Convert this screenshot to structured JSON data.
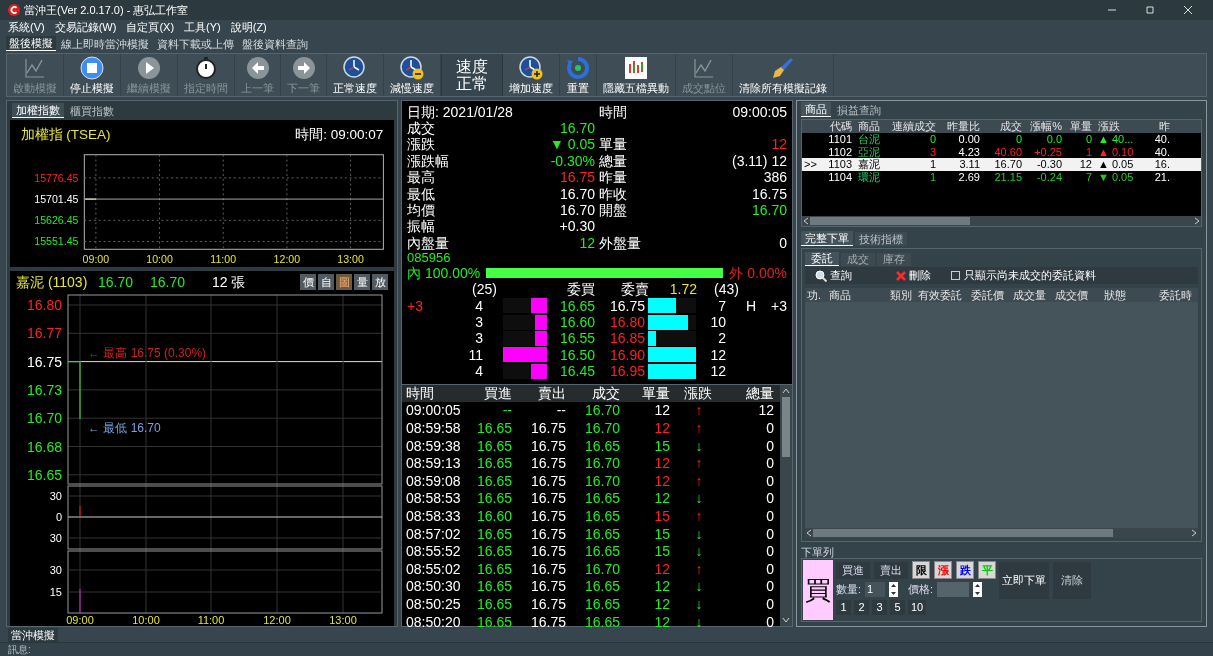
{
  "window": {
    "title": "當沖王(Ver 2.0.17.0) - 惠弘工作室"
  },
  "menu": [
    "系統(V)",
    "交易記錄(W)",
    "自定頁(X)",
    "工具(Y)",
    "說明(Z)"
  ],
  "tabs": [
    {
      "label": "盤後模擬",
      "selected": true
    },
    {
      "label": "線上即時當沖模擬",
      "selected": false
    },
    {
      "label": "資料下載或上傳",
      "selected": false
    },
    {
      "label": "盤後資料查詢",
      "selected": false
    }
  ],
  "toolbar": [
    {
      "kind": "button",
      "label": "啟動模擬",
      "disabled": true
    },
    {
      "kind": "button",
      "label": "停止模擬",
      "disabled": false
    },
    {
      "kind": "button",
      "label": "繼續模擬",
      "disabled": true
    },
    {
      "kind": "button",
      "label": "指定時間",
      "disabled": true
    },
    {
      "kind": "button",
      "label": "上一筆",
      "disabled": true
    },
    {
      "kind": "button",
      "label": "下一筆",
      "disabled": true
    },
    {
      "kind": "button",
      "label": "正常速度",
      "disabled": false
    },
    {
      "kind": "button",
      "label": "減慢速度",
      "disabled": false
    },
    {
      "kind": "display",
      "lines": [
        "速度",
        "正常"
      ]
    },
    {
      "kind": "button",
      "label": "增加速度",
      "disabled": false
    },
    {
      "kind": "button",
      "label": "重置",
      "disabled": false
    },
    {
      "kind": "button",
      "label": "隱藏五檔異動",
      "disabled": false
    },
    {
      "kind": "button",
      "label": "成交點位",
      "disabled": true
    },
    {
      "kind": "button",
      "label": "清除所有模擬記錄",
      "disabled": false
    }
  ],
  "index_panel": {
    "tabs": [
      {
        "label": "加權指數",
        "selected": true
      },
      {
        "label": "櫃買指數",
        "selected": false
      }
    ],
    "title": "加權指 (TSEA)",
    "time": "時間: 09:00:07",
    "y_labels": [
      {
        "text": "15776.45",
        "color": "#ff2020"
      },
      {
        "text": "15701.45",
        "color": "#ffffff"
      },
      {
        "text": "15626.45",
        "color": "#22ee22"
      },
      {
        "text": "15551.45",
        "color": "#22ee22"
      }
    ],
    "x_labels": [
      "09:00",
      "10:00",
      "11:00",
      "12:00",
      "13:00"
    ]
  },
  "stock_chart": {
    "name": "嘉泥 (1103)",
    "price": "16.70",
    "open": "16.70",
    "volume": "12 張",
    "buttons": [
      {
        "label": "價",
        "selected": false
      },
      {
        "label": "自",
        "selected": false
      },
      {
        "label": "圖",
        "selected": true
      },
      {
        "label": "量",
        "selected": false
      },
      {
        "label": "放",
        "selected": false
      }
    ],
    "price_labels": [
      {
        "text": "16.80",
        "color": "#ff2020"
      },
      {
        "text": "16.77",
        "color": "#ff2020"
      },
      {
        "text": "16.75",
        "color": "#ffffff"
      },
      {
        "text": "16.73",
        "color": "#22ee22"
      },
      {
        "text": "16.70",
        "color": "#22ee22"
      },
      {
        "text": "16.68",
        "color": "#22ee22"
      },
      {
        "text": "16.65",
        "color": "#22ee22"
      }
    ],
    "high_note": "← 最高 16.75 (0.30%)",
    "low_note": "← 最低 16.70",
    "volume_labels": [
      "30",
      "0",
      "30"
    ],
    "lower_labels": [
      "30",
      "15"
    ],
    "x_labels": [
      "09:00",
      "10:00",
      "11:00",
      "12:00",
      "13:00"
    ]
  },
  "quote": {
    "date": "日期: 2021/01/28",
    "time_label": "時間",
    "time": "09:00:05",
    "rows": [
      {
        "left": {
          "label": "成交",
          "value": "16.70",
          "color": "#22ee22"
        }
      },
      {
        "left": {
          "label": "漲跌",
          "value": "▼ 0.05",
          "color": "#22ee22"
        },
        "right": {
          "label": "單量",
          "value": "12",
          "color": "#ff2020"
        }
      },
      {
        "left": {
          "label": "漲跌幅",
          "value": "-0.30%",
          "color": "#22ee22"
        },
        "right": {
          "label": "總量",
          "value": "(3.11) 12",
          "color": "#ffffff"
        }
      },
      {
        "left": {
          "label": "最高",
          "value": "16.75",
          "color": "#ff2020"
        },
        "right": {
          "label": "昨量",
          "value": "386",
          "color": "#ffffff"
        }
      },
      {
        "left": {
          "label": "最低",
          "value": "16.70",
          "color": "#ffffff"
        },
        "right": {
          "label": "昨收",
          "value": "16.75",
          "color": "#ffffff"
        }
      },
      {
        "left": {
          "label": "均價",
          "value": "16.70",
          "color": "#ffffff"
        },
        "right": {
          "label": "開盤",
          "value": "16.70",
          "color": "#22ee22"
        }
      },
      {
        "left": {
          "label": "振幅",
          "value": "+0.30",
          "color": "#ffffff"
        }
      },
      {
        "left": {
          "label": "內盤量",
          "value": "12",
          "color": "#22ee22"
        },
        "right": {
          "label": "外盤量",
          "value": "0",
          "color": "#ffffff"
        }
      }
    ],
    "code": "085956",
    "inner": "內 100.00%",
    "outer": "外 0.00%",
    "ratio_bar": {
      "level": 1
    }
  },
  "book": {
    "bid_total": "(25)",
    "bid_head": "委買",
    "ask_head": "委賣",
    "ratio": "1.72",
    "ask_total": "(43)",
    "left_mark": "+3",
    "flag": "H",
    "right_mark": "+3",
    "rows": [
      {
        "bid_qty": "4",
        "bid_bar": {
          "level": 0.36
        },
        "bid": "16.65",
        "ask": {
          "text": "16.75",
          "color": "#ffffff"
        },
        "ask_bar": {
          "level": 0.58
        },
        "ask_qty": "7"
      },
      {
        "bid_qty": "3",
        "bid_bar": {
          "level": 0.27
        },
        "bid": "16.60",
        "ask": {
          "text": "16.80",
          "color": "#ff2020"
        },
        "ask_bar": {
          "level": 0.83
        },
        "ask_qty": "10"
      },
      {
        "bid_qty": "3",
        "bid_bar": {
          "level": 0.27
        },
        "bid": "16.55",
        "ask": {
          "text": "16.85",
          "color": "#ff2020"
        },
        "ask_bar": {
          "level": 0.17
        },
        "ask_qty": "2"
      },
      {
        "bid_qty": "11",
        "bid_bar": {
          "level": 1
        },
        "bid": "16.50",
        "ask": {
          "text": "16.90",
          "color": "#ff2020"
        },
        "ask_bar": {
          "level": 1
        },
        "ask_qty": "12"
      },
      {
        "bid_qty": "4",
        "bid_bar": {
          "level": 0.36
        },
        "bid": "16.45",
        "ask": {
          "text": "16.95",
          "color": "#ff2020"
        },
        "ask_bar": {
          "level": 1
        },
        "ask_qty": "12"
      }
    ]
  },
  "ticks": {
    "columns": [
      "時間",
      "買進",
      "賣出",
      "成交",
      "單量",
      "漲跌",
      "總量"
    ],
    "rows": [
      {
        "kind": "open",
        "cells": [
          "09:00:05",
          "--",
          "--",
          "16.70",
          "12",
          "↑",
          "12"
        ]
      },
      {
        "kind": "tick",
        "color": "#ff2020",
        "cells": [
          "08:59:58",
          "16.65",
          "16.75",
          "16.70",
          "12",
          "↑",
          "0"
        ]
      },
      {
        "kind": "tick",
        "color": "#22ee22",
        "cells": [
          "08:59:38",
          "16.65",
          "16.75",
          "16.65",
          "15",
          "↓",
          "0"
        ]
      },
      {
        "kind": "tick",
        "color": "#ff2020",
        "cells": [
          "08:59:13",
          "16.65",
          "16.75",
          "16.70",
          "12",
          "↑",
          "0"
        ]
      },
      {
        "kind": "tick",
        "color": "#ff2020",
        "cells": [
          "08:59:08",
          "16.65",
          "16.75",
          "16.70",
          "12",
          "↑",
          "0"
        ]
      },
      {
        "kind": "tick",
        "color": "#22ee22",
        "cells": [
          "08:58:53",
          "16.65",
          "16.75",
          "16.65",
          "12",
          "↓",
          "0"
        ]
      },
      {
        "kind": "tick",
        "color": "#ff2020",
        "cells": [
          "08:58:33",
          "16.60",
          "16.75",
          "16.65",
          "15",
          "↑",
          "0"
        ]
      },
      {
        "kind": "tick",
        "color": "#22ee22",
        "cells": [
          "08:57:02",
          "16.65",
          "16.75",
          "16.65",
          "15",
          "↓",
          "0"
        ]
      },
      {
        "kind": "tick",
        "color": "#22ee22",
        "cells": [
          "08:55:52",
          "16.65",
          "16.75",
          "16.65",
          "15",
          "↓",
          "0"
        ]
      },
      {
        "kind": "tick",
        "color": "#ff2020",
        "cells": [
          "08:55:02",
          "16.65",
          "16.75",
          "16.70",
          "12",
          "↑",
          "0"
        ]
      },
      {
        "kind": "tick",
        "color": "#22ee22",
        "cells": [
          "08:50:30",
          "16.65",
          "16.75",
          "16.65",
          "12",
          "↓",
          "0"
        ]
      },
      {
        "kind": "tick",
        "color": "#22ee22",
        "cells": [
          "08:50:25",
          "16.65",
          "16.75",
          "16.65",
          "12",
          "↓",
          "0"
        ]
      },
      {
        "kind": "tick",
        "color": "#22ee22",
        "cells": [
          "08:50:20",
          "16.65",
          "16.75",
          "16.65",
          "12",
          "↓",
          "0"
        ]
      }
    ]
  },
  "products": {
    "tabs": [
      {
        "label": "商品",
        "selected": true
      },
      {
        "label": "損益查詢",
        "selected": false
      }
    ],
    "columns": [
      "代碼",
      "商品",
      "連續成交",
      "昨量比",
      "成交",
      "漲幅%",
      "單量",
      "漲跌",
      "昨"
    ],
    "rows": [
      {
        "selected": false,
        "color": "#22ee22",
        "cells": [
          "1101",
          "台泥",
          "0",
          "0.00",
          "0",
          "0.0",
          "0",
          "▲ 40...",
          "40."
        ]
      },
      {
        "selected": false,
        "color": "#ff2020",
        "cells": [
          "1102",
          "亞泥",
          "3",
          "4.23",
          "40.60",
          "+0.25",
          "1",
          "▲ 0.10",
          "40."
        ]
      },
      {
        "selected": true,
        "marker": ">>",
        "color": "#000000",
        "cells": [
          "1103",
          "嘉泥",
          "1",
          "3.11",
          "16.70",
          "-0.30",
          "12",
          "▲ 0.05",
          "16."
        ]
      },
      {
        "selected": false,
        "color": "#22cc22",
        "cells": [
          "1104",
          "環泥",
          "1",
          "2.69",
          "21.15",
          "-0.24",
          "7",
          "▼ 0.05",
          "21."
        ]
      }
    ]
  },
  "order": {
    "tabs": [
      {
        "label": "完整下單",
        "selected": true
      },
      {
        "label": "技術指標",
        "selected": false
      }
    ],
    "subtabs": [
      {
        "label": "委託",
        "selected": true
      },
      {
        "label": "成交",
        "selected": false
      },
      {
        "label": "庫存",
        "selected": false
      }
    ],
    "query": "查詢",
    "delete": "刪除",
    "filter": {
      "label": "只顯示尚未成交的委託資料",
      "checked": false
    },
    "columns": [
      "功.",
      "商品",
      "類別",
      "有效委託",
      "委託價",
      "成交量",
      "成交價",
      "狀態",
      "委託時"
    ]
  },
  "ticket": {
    "title": "下單列",
    "side": "買",
    "actions": [
      "買進",
      "賣出"
    ],
    "price_types": [
      {
        "label": "限",
        "color": "#000000"
      },
      {
        "label": "漲",
        "color": "#ff0000"
      },
      {
        "label": "跌",
        "color": "#0000ff"
      },
      {
        "label": "平",
        "color": "#00cc00"
      }
    ],
    "submit": "立即下單",
    "clear": "清除",
    "qty_label": "數量:",
    "qty": "1",
    "price_label": "價格:",
    "presets": [
      "1",
      "2",
      "3",
      "5",
      "10"
    ]
  },
  "bottom_tabs": [
    {
      "label": "當沖模擬",
      "selected": true
    }
  ],
  "status": "訊息:"
}
